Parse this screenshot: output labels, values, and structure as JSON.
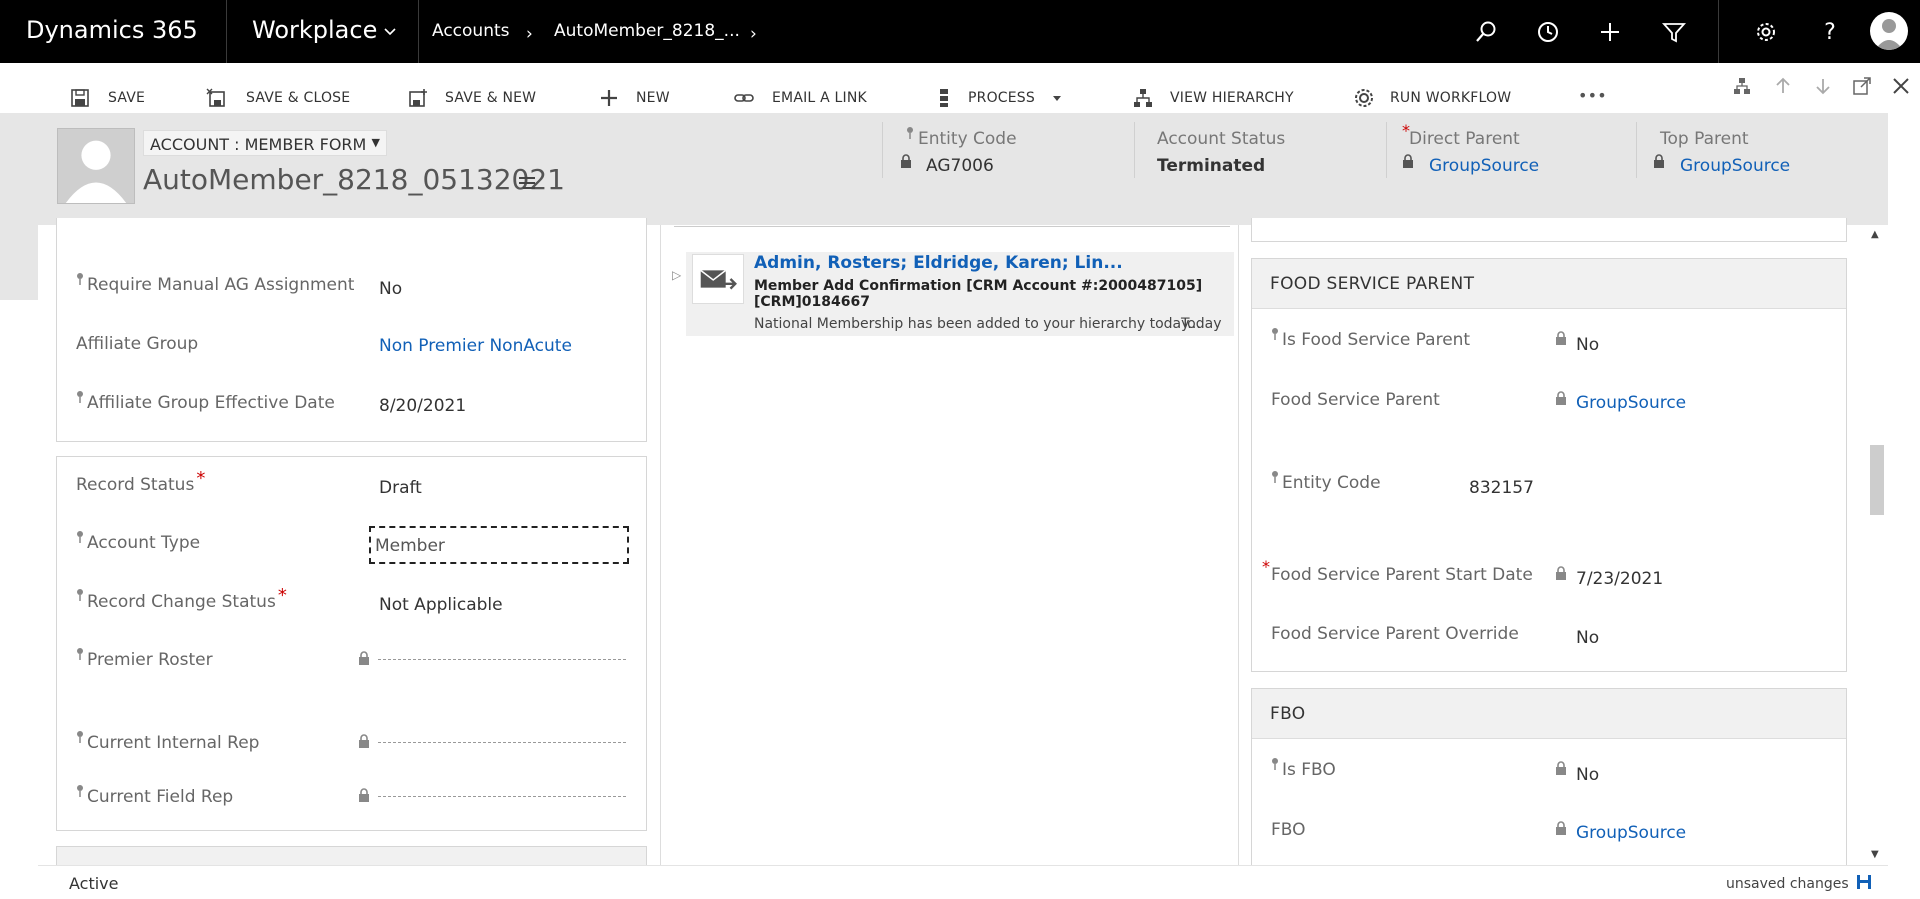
{
  "nav": {
    "brand": "Dynamics 365",
    "app": "Workplace",
    "breadcrumb_1": "Accounts",
    "breadcrumb_2": "AutoMember_8218_..."
  },
  "toolbar": {
    "save": "SAVE",
    "save_close": "SAVE & CLOSE",
    "save_new": "SAVE & NEW",
    "new": "NEW",
    "email_link": "EMAIL A LINK",
    "process": "PROCESS",
    "view_hierarchy": "VIEW HIERARCHY",
    "run_workflow": "RUN WORKFLOW",
    "more": "•••"
  },
  "header": {
    "form_selector": "ACCOUNT : MEMBER FORM",
    "record_name": "AutoMember_8218_05132021",
    "entity_code_label": "Entity Code",
    "entity_code_value": "AG7006",
    "account_status_label": "Account Status",
    "account_status_value": "Terminated",
    "direct_parent_label": "Direct Parent",
    "direct_parent_value": "GroupSource",
    "top_parent_label": "Top Parent",
    "top_parent_value": "GroupSource"
  },
  "left": {
    "require_manual_label": "Require Manual AG Assignment",
    "require_manual_value": "No",
    "affiliate_group_label": "Affiliate Group",
    "affiliate_group_value": "Non Premier NonAcute",
    "affiliate_date_label": "Affiliate Group Effective Date",
    "affiliate_date_value": "8/20/2021",
    "record_status_label": "Record Status",
    "record_status_value": "Draft",
    "account_type_label": "Account Type",
    "account_type_value": "Member",
    "record_change_label": "Record Change Status",
    "record_change_value": "Not Applicable",
    "premier_roster_label": "Premier Roster",
    "internal_rep_label": "Current Internal Rep",
    "field_rep_label": "Current Field Rep"
  },
  "activity": {
    "title": "Admin, Rosters; Eldridge, Karen; Lin...",
    "subject_1": "Member Add Confirmation [CRM Account #:2000487105]",
    "subject_2": "[CRM]0184667",
    "preview": "National Membership has been added to your hierarchy today...",
    "when": "Today"
  },
  "right": {
    "food_section": "FOOD SERVICE PARENT",
    "is_food_label": "Is Food Service Parent",
    "is_food_value": "No",
    "food_parent_label": "Food Service Parent",
    "food_parent_value": "GroupSource",
    "entity_code_label": "Entity Code",
    "entity_code_value": "832157",
    "food_start_label": "Food Service Parent Start Date",
    "food_start_value": "7/23/2021",
    "food_override_label": "Food Service Parent Override",
    "food_override_value": "No",
    "fbo_section": "FBO",
    "is_fbo_label": "Is FBO",
    "is_fbo_value": "No",
    "fbo_label": "FBO",
    "fbo_value": "GroupSource"
  },
  "status": {
    "state": "Active",
    "unsaved": "unsaved changes"
  }
}
